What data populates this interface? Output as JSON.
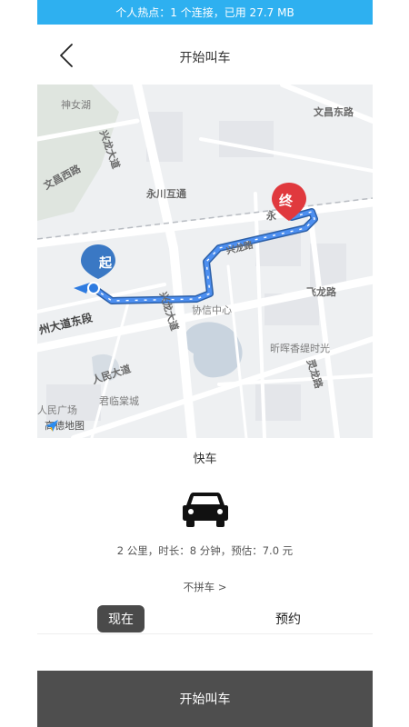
{
  "status_bar": {
    "hotspot_text": "个人热点：1 个连接，已用 27.7 MB"
  },
  "header": {
    "title": "开始叫车",
    "back_icon": "chevron-left-icon"
  },
  "map": {
    "labels": {
      "shennvhu": "神女湖",
      "wenchang_east": "文昌东路",
      "wenchang_west": "文昌西路",
      "xinglong_top": "兴龙大道",
      "xinglong_mid": "兴龙大道",
      "yongchuan_interchange": "永川互通",
      "yong_partial": "永",
      "xinglong_road": "兴龙路",
      "feilong_road": "飞龙路",
      "xiexin_center": "协信中心",
      "dazhou_east": "州大道东段",
      "renmin_avenue": "人民大道",
      "xinhui": "昕晖香缇时光",
      "lingxi": "灵龙路",
      "renmin_square": "人民广场",
      "junlin": "君临棠城"
    },
    "start_marker": "起",
    "end_marker": "终",
    "provider_logo": "高德地图",
    "route_color": "#3a7bd5",
    "start_marker_color": "#3a78c4",
    "end_marker_color": "#e0393e"
  },
  "ride": {
    "car_type": "快车",
    "car_icon": "car-icon",
    "trip_info": "2 公里，时长：8 分钟，预估：7.0 元",
    "carpool_option": "不拼车 >"
  },
  "time_tabs": {
    "now": "现在",
    "reserve": "预约",
    "selected": "now"
  },
  "actions": {
    "start_label": "开始叫车"
  },
  "colors": {
    "accent": "#2eb0f0",
    "button_dark": "#4e4e4e"
  }
}
